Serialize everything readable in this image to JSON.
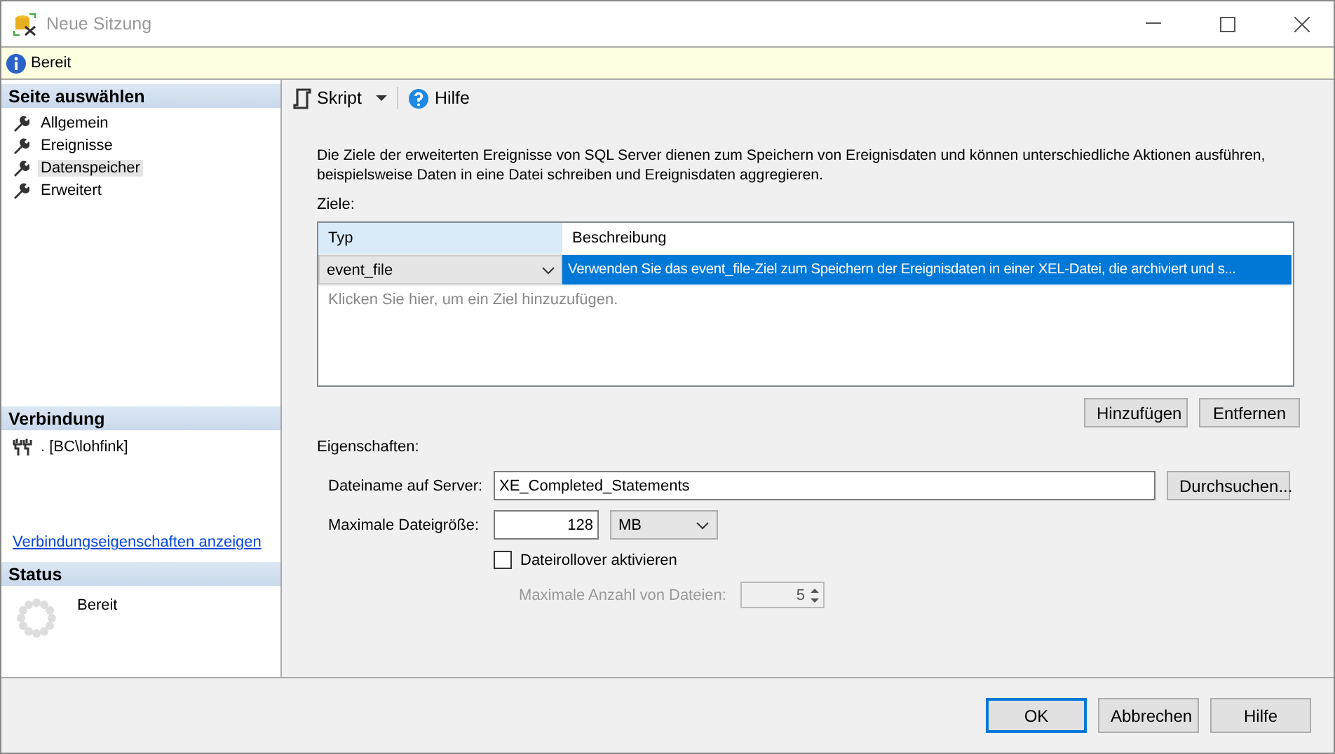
{
  "window": {
    "title": "Neue Sitzung"
  },
  "info_bar": {
    "text": "Bereit"
  },
  "sidebar": {
    "header": "Seite auswählen",
    "items": [
      {
        "label": "Allgemein",
        "selected": false
      },
      {
        "label": "Ereignisse",
        "selected": false
      },
      {
        "label": "Datenspeicher",
        "selected": true
      },
      {
        "label": "Erweitert",
        "selected": false
      }
    ]
  },
  "connection": {
    "header": "Verbindung",
    "server": ". [BC\\lohfink]",
    "link": "Verbindungseigenschaften anzeigen"
  },
  "status": {
    "header": "Status",
    "text": "Bereit"
  },
  "toolbar": {
    "script": "Skript",
    "help": "Hilfe"
  },
  "description": "Die Ziele der erweiterten Ereignisse von SQL Server dienen zum Speichern von Ereignisdaten und können unterschiedliche Aktionen ausführen, beispielsweise Daten in eine Datei schreiben und Ereignisdaten aggregieren.",
  "targets": {
    "label": "Ziele:",
    "columns": [
      "Typ",
      "Beschreibung"
    ],
    "rows": [
      {
        "type": "event_file",
        "description": "Verwenden Sie das event_file-Ziel zum Speichern der Ereignisdaten in einer XEL-Datei, die archiviert und s...",
        "selected": true
      }
    ],
    "placeholder": "Klicken Sie hier, um ein Ziel hinzuzufügen.",
    "buttons": [
      "Hinzufügen",
      "Entfernen"
    ]
  },
  "properties": {
    "label": "Eigenschaften:",
    "file_name": {
      "label": "Dateiname auf Server:",
      "value": "XE_Completed_Statements",
      "button": "Durchsuchen..."
    },
    "max_size": {
      "label": "Maximale Dateigröße:",
      "value": "128",
      "unit": "MB"
    },
    "rollover": {
      "label": "Dateirollover aktivieren",
      "checked": false
    },
    "max_files": {
      "label": "Maximale Anzahl von Dateien:",
      "value": "5",
      "disabled": true
    }
  },
  "buttons": [
    {
      "label": "OK",
      "focused": true
    },
    {
      "label": "Abbrechen",
      "focused": false
    },
    {
      "label": "Hilfe",
      "focused": false
    }
  ]
}
